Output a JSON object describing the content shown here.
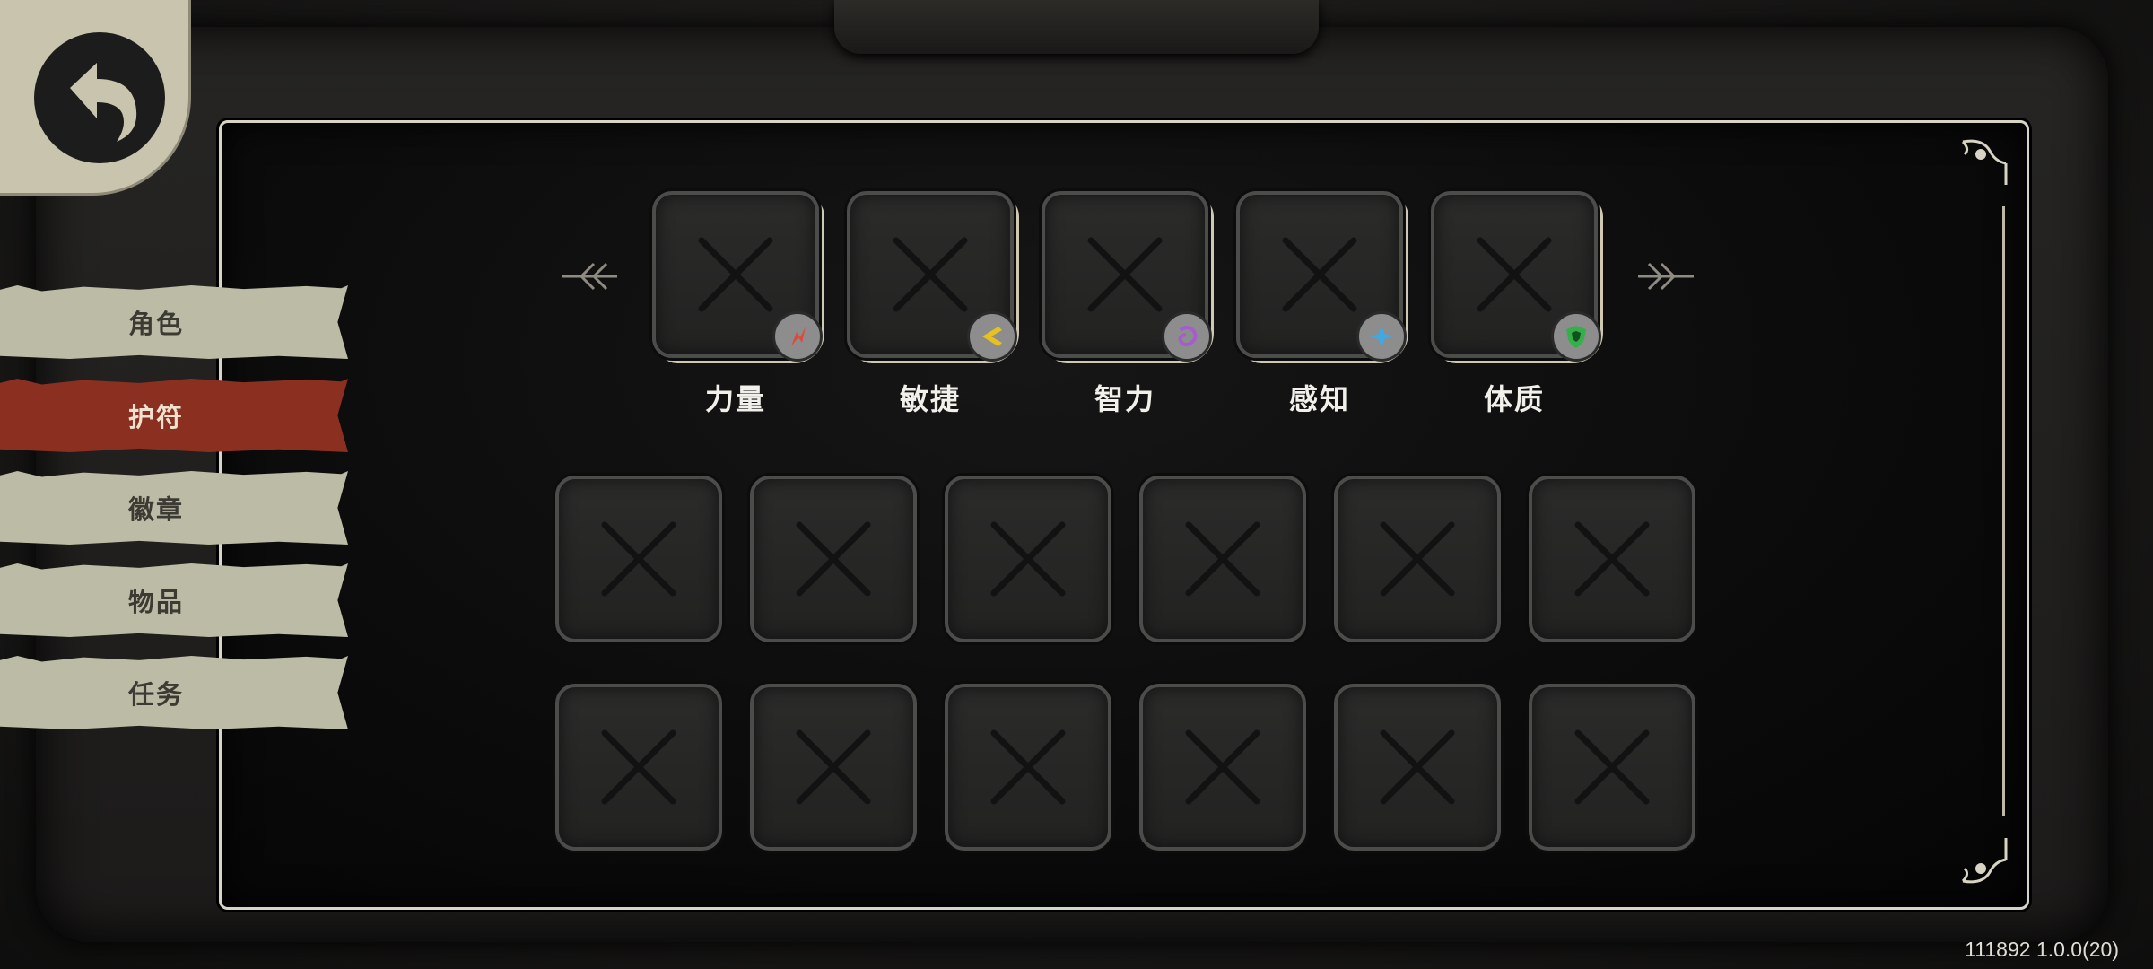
{
  "sidebar": {
    "tabs": [
      {
        "label": "角色",
        "active": false
      },
      {
        "label": "护符",
        "active": true
      },
      {
        "label": "徽章",
        "active": false
      },
      {
        "label": "物品",
        "active": false
      },
      {
        "label": "任务",
        "active": false
      }
    ]
  },
  "attributes": [
    {
      "label": "力量",
      "icon": "strength-icon",
      "color": "#e0483a"
    },
    {
      "label": "敏捷",
      "icon": "agility-icon",
      "color": "#e8c21c"
    },
    {
      "label": "智力",
      "icon": "intellect-icon",
      "color": "#a65ccf"
    },
    {
      "label": "感知",
      "icon": "perception-icon",
      "color": "#3fa9e6"
    },
    {
      "label": "体质",
      "icon": "constitution-icon",
      "color": "#34b04a"
    }
  ],
  "version": "111892 1.0.0(20)",
  "colors": {
    "active_tab": "#8b2f21",
    "inactive_tab": "#bcbba6",
    "frame": "#d8d4c4"
  }
}
